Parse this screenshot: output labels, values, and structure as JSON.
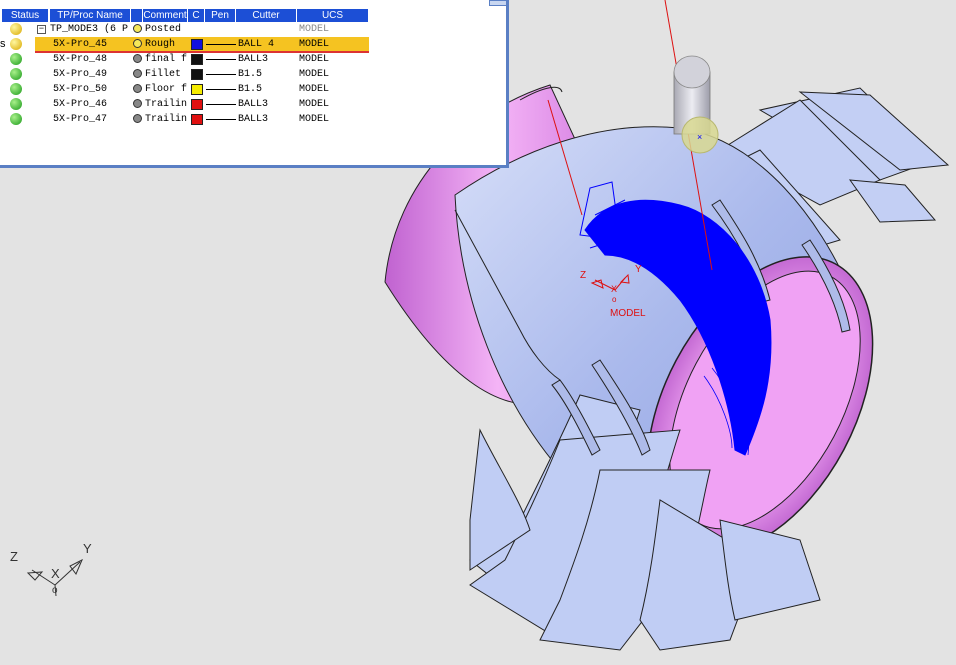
{
  "columns": [
    "Status",
    "TP/Proc Name",
    "Comment",
    "C",
    "Pen",
    "Cutter",
    "UCS"
  ],
  "rows": [
    {
      "status": "warn",
      "name": "TP_MODE3 (6 P",
      "comment": "Posted",
      "color": "",
      "cutter": "",
      "ucs": "MODEL",
      "group": true
    },
    {
      "status": "warn",
      "name": "5X-Pro_45",
      "comment": "Rough",
      "color": "#1010e0",
      "cutter": "BALL 4",
      "ucs": "MODEL",
      "selected": true
    },
    {
      "status": "ok",
      "name": "5X-Pro_48",
      "comment": "final f",
      "color": "#111111",
      "cutter": "BALL3",
      "ucs": "MODEL"
    },
    {
      "status": "ok",
      "name": "5X-Pro_49",
      "comment": "Fillet",
      "color": "#111111",
      "cutter": "B1.5",
      "ucs": "MODEL"
    },
    {
      "status": "ok",
      "name": "5X-Pro_50",
      "comment": "Floor f",
      "color": "#f5ec00",
      "cutter": "B1.5",
      "ucs": "MODEL"
    },
    {
      "status": "ok",
      "name": "5X-Pro_46",
      "comment": "Trailin",
      "color": "#e01010",
      "cutter": "BALL3",
      "ucs": "MODEL"
    },
    {
      "status": "ok",
      "name": "5X-Pro_47",
      "comment": "Trailin",
      "color": "#e01010",
      "cutter": "BALL3",
      "ucs": "MODEL"
    }
  ],
  "side_marker": "s",
  "scene": {
    "model_axes": {
      "z": "Z",
      "y": "Y",
      "x": "X",
      "origin": "o",
      "label": "MODEL"
    },
    "view_triad": {
      "z": "Z",
      "y": "Y",
      "x": "X",
      "origin": "o"
    },
    "colors": {
      "hub": "#b4c2ef",
      "blade": "#c0cdf4",
      "shroud": "#e18ae8",
      "toolpath": "#0000ff",
      "tool": "#c9c9d2",
      "axis": "#d11"
    }
  }
}
